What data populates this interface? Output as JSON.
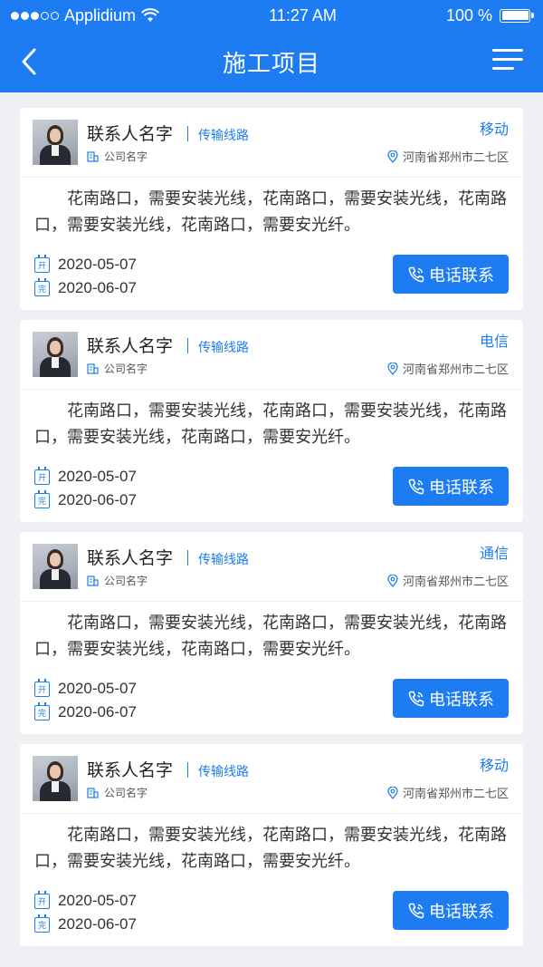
{
  "status_bar": {
    "carrier": "Applidium",
    "time": "11:27 AM",
    "battery": "100 %"
  },
  "header": {
    "title": "施工项目",
    "back_icon": "chevron-left-icon",
    "menu_icon": "menu-icon"
  },
  "colors": {
    "primary": "#1e7cf2",
    "background": "#eef0f3"
  },
  "cards": [
    {
      "contact_name": "联系人名字",
      "line_tag": "传输线路",
      "company": "公司名字",
      "carrier": "移动",
      "location": "河南省郑州市二七区",
      "description": "花南路口，需要安装光线，花南路口，需要安装光线，花南路口，需要安装光线，花南路口，需要安光纤。",
      "start_label": "开",
      "start_date": "2020-05-07",
      "end_label": "完",
      "end_date": "2020-06-07",
      "call_label": "电话联系"
    },
    {
      "contact_name": "联系人名字",
      "line_tag": "传输线路",
      "company": "公司名字",
      "carrier": "电信",
      "location": "河南省郑州市二七区",
      "description": "花南路口，需要安装光线，花南路口，需要安装光线，花南路口，需要安装光线，花南路口，需要安光纤。",
      "start_label": "开",
      "start_date": "2020-05-07",
      "end_label": "完",
      "end_date": "2020-06-07",
      "call_label": "电话联系"
    },
    {
      "contact_name": "联系人名字",
      "line_tag": "传输线路",
      "company": "公司名字",
      "carrier": "通信",
      "location": "河南省郑州市二七区",
      "description": "花南路口，需要安装光线，花南路口，需要安装光线，花南路口，需要安装光线，花南路口，需要安光纤。",
      "start_label": "开",
      "start_date": "2020-05-07",
      "end_label": "完",
      "end_date": "2020-06-07",
      "call_label": "电话联系"
    },
    {
      "contact_name": "联系人名字",
      "line_tag": "传输线路",
      "company": "公司名字",
      "carrier": "移动",
      "location": "河南省郑州市二七区",
      "description": "花南路口，需要安装光线，花南路口，需要安装光线，花南路口，需要安装光线，花南路口，需要安光纤。",
      "start_label": "开",
      "start_date": "2020-05-07",
      "end_label": "完",
      "end_date": "2020-06-07",
      "call_label": "电话联系"
    }
  ]
}
